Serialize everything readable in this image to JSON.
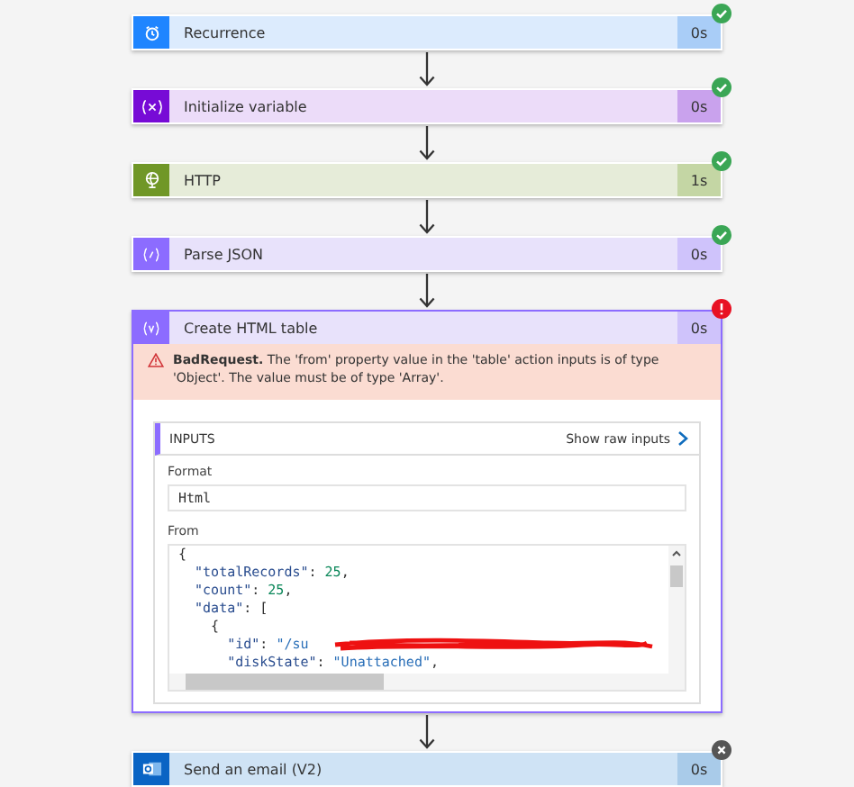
{
  "steps": [
    {
      "kind": "recurrence",
      "title": "Recurrence",
      "duration": "0s",
      "badge": {
        "kind": "succeeded"
      },
      "color": "#1f85ff"
    },
    {
      "kind": "variable",
      "title": "Initialize variable",
      "duration": "0s",
      "badge": {
        "kind": "succeeded"
      },
      "color": "#770bd6"
    },
    {
      "kind": "http",
      "title": "HTTP",
      "duration": "1s",
      "badge": {
        "kind": "succeeded"
      },
      "color": "#709727"
    },
    {
      "kind": "parse",
      "title": "Parse JSON",
      "duration": "0s",
      "badge": {
        "kind": "succeeded"
      },
      "color": "#8c6cff"
    },
    {
      "kind": "table",
      "title": "Create HTML table",
      "duration": "0s",
      "badge": {
        "kind": "failed"
      },
      "color": "#8c6cff",
      "expanded": true,
      "error": {
        "code": "BadRequest.",
        "message": "The 'from' property value in the 'table' action inputs is of type 'Object'. The value must be of type 'Array'."
      },
      "inputs": {
        "heading": "INPUTS",
        "raw_link": "Show raw inputs",
        "fields": [
          {
            "label": "Format",
            "kind": "text",
            "value": "Html"
          },
          {
            "label": "From",
            "kind": "code",
            "lines": [
              [
                {
                  "kind": "punct",
                  "text": "{"
                }
              ],
              [
                {
                  "kind": "key",
                  "text": "  \"totalRecords\""
                },
                {
                  "kind": "punct",
                  "text": ": "
                },
                {
                  "kind": "number",
                  "text": "25"
                },
                {
                  "kind": "punct",
                  "text": ","
                }
              ],
              [
                {
                  "kind": "key",
                  "text": "  \"count\""
                },
                {
                  "kind": "punct",
                  "text": ": "
                },
                {
                  "kind": "number",
                  "text": "25"
                },
                {
                  "kind": "punct",
                  "text": ","
                }
              ],
              [
                {
                  "kind": "key",
                  "text": "  \"data\""
                },
                {
                  "kind": "punct",
                  "text": ": ["
                }
              ],
              [
                {
                  "kind": "punct",
                  "text": "    {"
                }
              ],
              [
                {
                  "kind": "key",
                  "text": "      \"id\""
                },
                {
                  "kind": "punct",
                  "text": ": "
                },
                {
                  "kind": "string",
                  "text": "\"/su"
                },
                {
                  "kind": "redaction"
                }
              ],
              [
                {
                  "kind": "key",
                  "text": "      \"diskState\""
                },
                {
                  "kind": "punct",
                  "text": ": "
                },
                {
                  "kind": "string",
                  "text": "\"Unattached\""
                },
                {
                  "kind": "punct",
                  "text": ","
                }
              ]
            ]
          }
        ]
      }
    },
    {
      "kind": "outlook",
      "title": "Send an email (V2)",
      "duration": "0s",
      "badge": {
        "kind": "skipped"
      },
      "color": "#0a64c4"
    }
  ]
}
